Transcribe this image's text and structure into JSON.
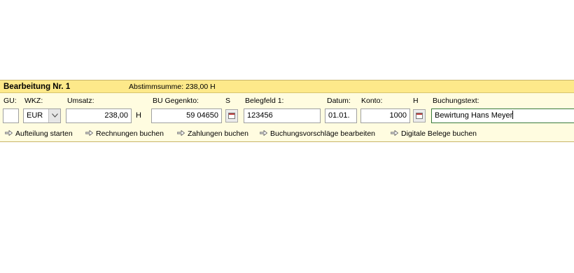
{
  "header": {
    "title": "Bearbeitung Nr. 1",
    "abstimmsumme": "Abstimmsumme: 238,00 H"
  },
  "labels": {
    "gu": "GU:",
    "wkz": "WKZ:",
    "umsatz": "Umsatz:",
    "bu_gegenkto": "BU Gegenkto:",
    "s": "S",
    "belegfeld1": "Belegfeld 1:",
    "datum": "Datum:",
    "konto": "Konto:",
    "h": "H",
    "buchungstext": "Buchungstext:"
  },
  "fields": {
    "gu": "",
    "wkz": "EUR",
    "umsatz": "238,00",
    "umsatz_sh": "H",
    "bu_gegenkto": "59 04650",
    "belegfeld1": "123456",
    "datum": "01.01.",
    "konto": "1000",
    "buchungstext": "Bewirtung Hans Meyer"
  },
  "actions": [
    {
      "label": "Aufteilung starten",
      "icon": "arrow-right-icon"
    },
    {
      "label": "Rechnungen buchen",
      "icon": "arrow-right-icon"
    },
    {
      "label": "Zahlungen buchen",
      "icon": "arrow-right-icon"
    },
    {
      "label": "Buchungsvorschläge bearbeiten",
      "icon": "arrow-right-icon"
    },
    {
      "label": "Digitale Belege buchen",
      "icon": "arrow-right-icon"
    }
  ],
  "colors": {
    "panel_bg": "#fffce0",
    "titlebar_bg": "#fde98a",
    "focus_border": "#3a7a3a"
  }
}
